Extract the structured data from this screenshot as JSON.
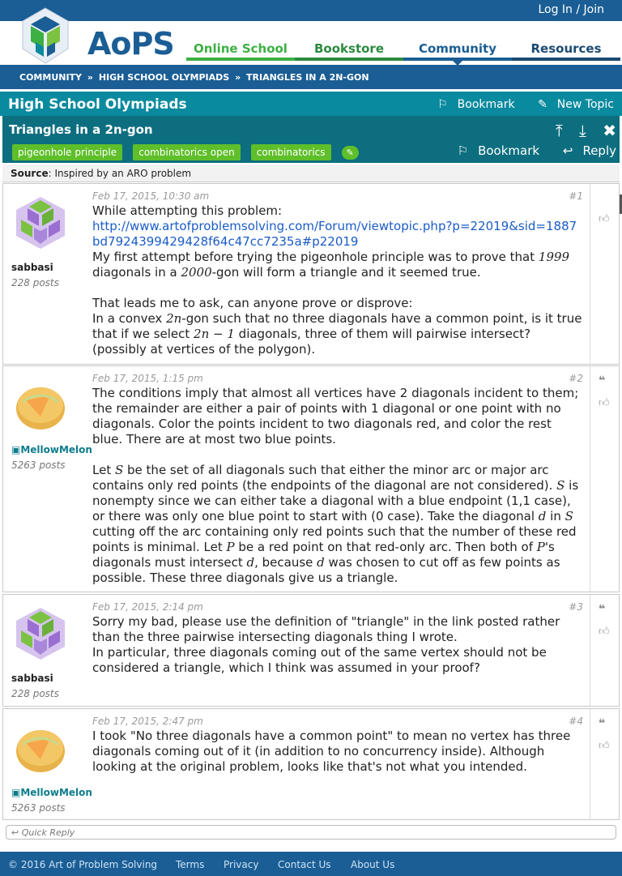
{
  "header": {
    "login_label": "Log In / Join",
    "logo_text": "AoPS",
    "nav": [
      "Online School",
      "Bookstore",
      "Community",
      "Resources"
    ],
    "breadcrumbs": [
      "COMMUNITY",
      "HIGH SCHOOL OLYMPIADS",
      "TRIANGLES IN A 2N-GON"
    ],
    "breadcrumb_sep": "»"
  },
  "forum": {
    "title": "High School Olympiads",
    "bookmark_label": "Bookmark",
    "new_topic_label": "New Topic"
  },
  "topic": {
    "title": "Triangles in a 2n-gon",
    "tags": [
      "pigeonhole principle",
      "combinatorics open",
      "combinatorics"
    ],
    "bookmark_label": "Bookmark",
    "reply_label": "Reply",
    "source_label": "Source",
    "source_text": ": Inspired by an ARO problem"
  },
  "posts": [
    {
      "author": "sabbasi",
      "posts_count": "228 posts",
      "date": "Feb 17, 2015, 10:30 am",
      "number": "#1",
      "lines": {
        "l1": "While attempting this problem:",
        "link": "http://www.artofproblemsolving.com/Forum/viewtopic.php?p=22019&sid=1887bd7924399429428f64c47cc7235a#p22019",
        "l2a": "My first attempt before trying the pigeonhole principle was to prove that ",
        "m1": "1999",
        "l2b": " diagonals in a ",
        "m2": "2000",
        "l2c": "-gon will form a triangle and it seemed true.",
        "l3": "That leads me to ask, can anyone prove or disprove:",
        "l4a": "In a convex ",
        "m3": "2n",
        "l4b": "-gon such that no three diagonals have a common point, is it true that if we select ",
        "m4": "2n − 1",
        "l4c": " diagonals, three of them will pairwise intersect? (possibly at vertices of the polygon)."
      }
    },
    {
      "author": "MellowMelon",
      "posts_count": "5263 posts",
      "date": "Feb 17, 2015, 1:15 pm",
      "number": "#2",
      "lines": {
        "p1": "The conditions imply that almost all vertices have 2 diagonals incident to them; the remainder are either a pair of points with 1 diagonal or one point with no diagonals. Color the points incident to two diagonals red, and color the rest blue. There are at most two blue points.",
        "a": "Let ",
        "mS": "S",
        "b": " be the set of all diagonals such that either the minor arc or major arc contains only red points (the endpoints of the diagonal are not considered). ",
        "c": " is nonempty since we can either take a diagonal with a blue endpoint (1,1 case), or there was only one blue point to start with (0 case). Take the diagonal ",
        "md": "d",
        "d": " in ",
        "e": " cutting off the arc containing only red points such that the number of these red points is minimal. Let ",
        "mP": "P",
        "f": " be a red point on that red-only arc. Then both of ",
        "g": "'s diagonals must intersect ",
        "h": ", because ",
        "i": " was chosen to cut off as few points as possible. These three diagonals give us a triangle."
      }
    },
    {
      "author": "sabbasi",
      "posts_count": "228 posts",
      "date": "Feb 17, 2015, 2:14 pm",
      "number": "#3",
      "lines": {
        "l1": "Sorry my bad, please use the definition of \"triangle\" in the link posted rather than the three pairwise intersecting diagonals thing I wrote.",
        "l2": "In particular, three diagonals coming out of the same vertex should not be considered a triangle, which I think was assumed in your proof?"
      }
    },
    {
      "author": "MellowMelon",
      "posts_count": "5263 posts",
      "date": "Feb 17, 2015, 2:47 pm",
      "number": "#4",
      "lines": {
        "l1": "I took \"No three diagonals have a common point\" to mean no vertex has three diagonals coming out of it (in addition to no concurrency inside). Although looking at the original problem, looks like that's not what you intended."
      }
    }
  ],
  "quick_reply_label": "Quick Reply",
  "footer": {
    "copyright": "© 2016 Art of Problem Solving",
    "links": [
      "Terms",
      "Privacy",
      "Contact Us",
      "About Us"
    ]
  }
}
